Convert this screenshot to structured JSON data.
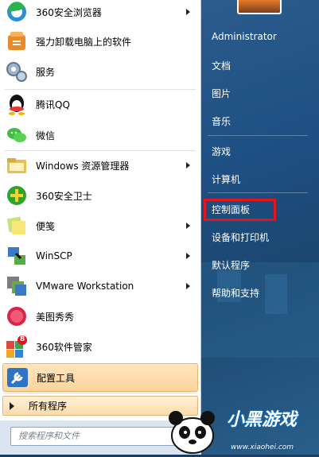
{
  "start_menu": {
    "programs": [
      {
        "label": "360安全浏览器",
        "icon": "browser-360-icon",
        "has_submenu": true
      },
      {
        "label": "强力卸载电脑上的软件",
        "icon": "uninstall-icon",
        "has_submenu": false
      },
      {
        "label": "服务",
        "icon": "gears-icon",
        "has_submenu": false
      },
      {
        "label": "腾讯QQ",
        "icon": "qq-penguin-icon",
        "has_submenu": false
      },
      {
        "label": "微信",
        "icon": "wechat-icon",
        "has_submenu": false
      },
      {
        "label": "Windows 资源管理器",
        "icon": "folder-explorer-icon",
        "has_submenu": true
      },
      {
        "label": "360安全卫士",
        "icon": "shield-360-icon",
        "has_submenu": false
      },
      {
        "label": "便笺",
        "icon": "sticky-notes-icon",
        "has_submenu": true
      },
      {
        "label": "WinSCP",
        "icon": "winscp-icon",
        "has_submenu": true
      },
      {
        "label": "VMware Workstation",
        "icon": "vmware-icon",
        "has_submenu": true
      },
      {
        "label": "美图秀秀",
        "icon": "meitu-icon",
        "has_submenu": false
      },
      {
        "label": "360软件管家",
        "icon": "software-manager-360-icon",
        "has_submenu": false,
        "badge": "8"
      },
      {
        "label": "配置工具",
        "icon": "config-tool-icon",
        "has_submenu": false,
        "highlighted": true
      }
    ],
    "all_programs_label": "所有程序",
    "search_placeholder": "搜索程序和文件",
    "right_items": [
      {
        "label": "Administrator"
      },
      {
        "label": "文档"
      },
      {
        "label": "图片"
      },
      {
        "label": "音乐"
      },
      {
        "label": "游戏"
      },
      {
        "label": "计算机"
      },
      {
        "label": "控制面板",
        "highlighted_box": true
      },
      {
        "label": "设备和打印机"
      },
      {
        "label": "默认程序"
      },
      {
        "label": "帮助和支持"
      }
    ]
  },
  "watermark": {
    "title": "小黑游戏",
    "url": "www.xiaohei.com"
  },
  "colors": {
    "highlight_border": "#e5141b",
    "right_panel": "#1e4f84",
    "selected_item": "#fbd49c"
  }
}
